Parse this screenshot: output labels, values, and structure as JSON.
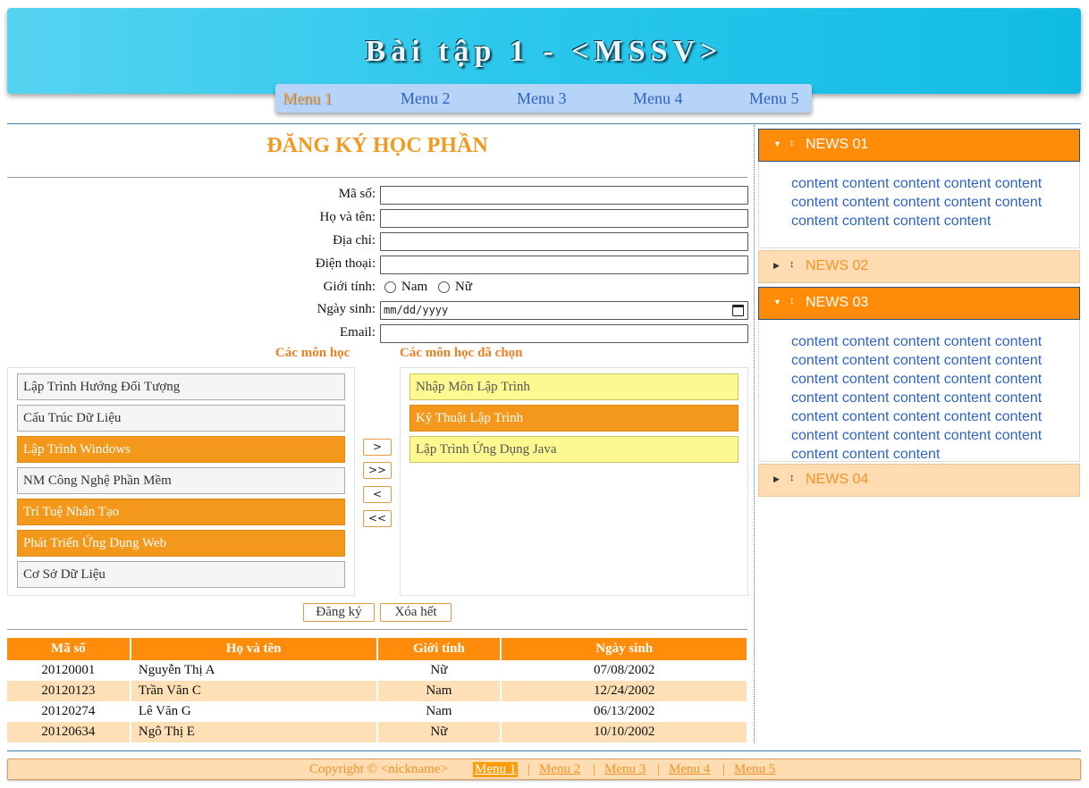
{
  "header": {
    "title": "Bài tập 1 - <MSSV>",
    "menu": [
      "Menu 1",
      "Menu 2",
      "Menu 3",
      "Menu 4",
      "Menu 5"
    ],
    "active_menu": "Menu 1"
  },
  "form": {
    "title": "ĐĂNG KÝ HỌC PHẦN",
    "fields": {
      "ma_so": "Mã số:",
      "ho_ten": "Họ và tên:",
      "dia_chi": "Địa chỉ:",
      "dien_thoai": "Điện thoại:",
      "gioi_tinh": "Giới tính:",
      "ngay_sinh": "Ngày sinh:",
      "email": "Email:"
    },
    "gender_options": [
      "Nam",
      "Nữ"
    ],
    "date_placeholder": "mm/dd/yyyy",
    "available_heading": "Các môn học",
    "selected_heading": "Các môn học đã chọn",
    "available": [
      {
        "label": "Lập Trình Hướng Đối Tượng",
        "selected": false
      },
      {
        "label": "Cấu Trúc Dữ Liệu",
        "selected": false
      },
      {
        "label": "Lập Trình Windows",
        "selected": true
      },
      {
        "label": "NM Công Nghệ Phần Mềm",
        "selected": false
      },
      {
        "label": "Trí Tuệ Nhân Tạo",
        "selected": true
      },
      {
        "label": "Phát Triển Ứng Dụng Web",
        "selected": true
      },
      {
        "label": "Cơ Sở Dữ Liệu",
        "selected": false
      }
    ],
    "chosen": [
      {
        "label": "Nhập Môn Lập Trình",
        "selected": false
      },
      {
        "label": "Kỹ Thuật Lập Trình",
        "selected": true
      },
      {
        "label": "Lập Trình Ứng Dụng Java",
        "selected": false
      }
    ],
    "move_buttons": [
      ">",
      ">>",
      "<",
      "<<"
    ],
    "register_label": "Đăng ký",
    "clear_label": "Xóa hết"
  },
  "table": {
    "headers": [
      "Mã số",
      "Họ và tên",
      "Giới tính",
      "Ngày sinh"
    ],
    "rows": [
      [
        "20120001",
        "Nguyễn Thị A",
        "Nữ",
        "07/08/2002"
      ],
      [
        "20120123",
        "Trần Văn C",
        "Nam",
        "12/24/2002"
      ],
      [
        "20120274",
        "Lê Văn G",
        "Nam",
        "06/13/2002"
      ],
      [
        "20120634",
        "Ngô Thị E",
        "Nữ",
        "10/10/2002"
      ]
    ]
  },
  "news": [
    {
      "title": "NEWS 01",
      "open": true,
      "content": "content content content content content content content content content content content content content content"
    },
    {
      "title": "NEWS 02",
      "open": false,
      "content": ""
    },
    {
      "title": "NEWS 03",
      "open": true,
      "content": "content content content content content content content content content content content content content content content content content content content content content content content content content content content content content content content content content"
    },
    {
      "title": "NEWS 04",
      "open": false,
      "content": ""
    }
  ],
  "footer": {
    "copyright": "Copyright © <nickname>",
    "links": [
      "Menu 1",
      "Menu 2",
      "Menu 3",
      "Menu 4",
      "Menu 5"
    ],
    "active_link": "Menu 1",
    "separator": "|"
  },
  "colors": {
    "header_gradient_start": "#55d3f0",
    "header_gradient_end": "#10bce3",
    "accent_orange": "#ff8c0a",
    "light_orange": "#ffdcb1",
    "menu_blue": "#b5d4f7",
    "link_blue": "#2e63c8",
    "chosen_yellow": "#fdf990"
  }
}
